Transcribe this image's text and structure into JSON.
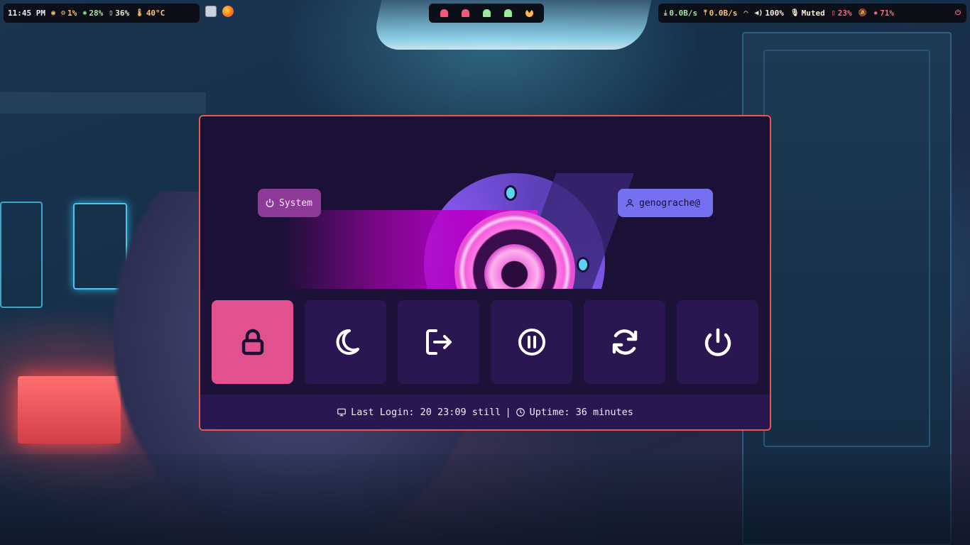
{
  "top_bar": {
    "left": {
      "time": "11:45 PM",
      "cpu": "1%",
      "memory": "28%",
      "disk": "36%",
      "temperature": "40°C",
      "apps": [
        "files",
        "firefox"
      ]
    },
    "workspaces": [
      {
        "icon": "ghost-icon",
        "color": "#f05a78"
      },
      {
        "icon": "ghost-icon",
        "color": "#f05a78"
      },
      {
        "icon": "ghost-icon",
        "color": "#9ee89e"
      },
      {
        "icon": "ghost-icon",
        "color": "#9ee89e"
      },
      {
        "icon": "pacman-icon",
        "color": "#ffb84d"
      }
    ],
    "right": {
      "download": "0.0B/s",
      "upload": "0.0B/s",
      "volume": "100%",
      "mic": "Muted",
      "battery": "23%",
      "brightness": "71%"
    }
  },
  "power_menu": {
    "system_label": "System",
    "user_label": "genograche@",
    "buttons": [
      {
        "action": "lock",
        "icon": "lock-icon",
        "active": true
      },
      {
        "action": "suspend",
        "icon": "moon-icon",
        "active": false
      },
      {
        "action": "logout",
        "icon": "logout-icon",
        "active": false
      },
      {
        "action": "hibernate",
        "icon": "pause-icon",
        "active": false
      },
      {
        "action": "reboot",
        "icon": "refresh-icon",
        "active": false
      },
      {
        "action": "shutdown",
        "icon": "power-icon",
        "active": false
      }
    ],
    "footer": {
      "last_login": "Last Login: 20 23:09 still",
      "separator": "|",
      "uptime": "Uptime: 36 minutes"
    }
  },
  "colors": {
    "border_accent": "#e8584f",
    "active_button": "#e1518f",
    "button_bg": "#2a1650",
    "user_chip": "#7570f0",
    "system_chip": "#8e3a98"
  }
}
